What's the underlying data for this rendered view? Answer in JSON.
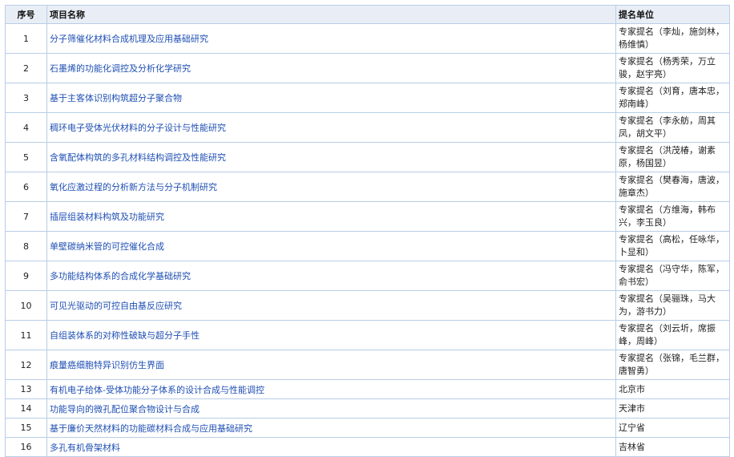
{
  "table": {
    "headers": [
      "序号",
      "项目名称",
      "提名单位"
    ],
    "rows": [
      {
        "no": "1",
        "name": "分子筛催化材料合成机理及应用基础研究",
        "unit": "专家提名（李灿，施剑林，杨维慎）"
      },
      {
        "no": "2",
        "name": "石墨烯的功能化调控及分析化学研究",
        "unit": "专家提名（杨秀荣，万立骏，赵宇亮）"
      },
      {
        "no": "3",
        "name": "基于主客体识别构筑超分子聚合物",
        "unit": "专家提名（刘育，唐本忠，郑南峰）"
      },
      {
        "no": "4",
        "name": "稠环电子受体光伏材料的分子设计与性能研究",
        "unit": "专家提名（李永舫，周其凤，胡文平）"
      },
      {
        "no": "5",
        "name": "含氧配体构筑的多孔材料结构调控及性能研究",
        "unit": "专家提名（洪茂椿，谢素原，杨国昱）"
      },
      {
        "no": "6",
        "name": "氧化应激过程的分析新方法与分子机制研究",
        "unit": "专家提名（樊春海，唐波，施章杰）"
      },
      {
        "no": "7",
        "name": "插层组装材料构筑及功能研究",
        "unit": "专家提名（方维海，韩布兴，李玉良）"
      },
      {
        "no": "8",
        "name": "单壁碳纳米管的可控催化合成",
        "unit": "专家提名（高松，任咏华，卜显和）"
      },
      {
        "no": "9",
        "name": "多功能结构体系的合成化学基础研究",
        "unit": "专家提名（冯守华，陈军，俞书宏）"
      },
      {
        "no": "10",
        "name": "可见光驱动的可控自由基反应研究",
        "unit": "专家提名（吴骊珠，马大为，游书力）"
      },
      {
        "no": "11",
        "name": "自组装体系的对称性破缺与超分子手性",
        "unit": "专家提名（刘云圻，席振峰，周峰）"
      },
      {
        "no": "12",
        "name": "痕量癌细胞特异识别仿生界面",
        "unit": "专家提名（张锦，毛兰群，唐智勇）"
      },
      {
        "no": "13",
        "name": "有机电子给体-受体功能分子体系的设计合成与性能调控",
        "unit": "北京市"
      },
      {
        "no": "14",
        "name": "功能导向的微孔配位聚合物设计与合成",
        "unit": "天津市"
      },
      {
        "no": "15",
        "name": "基于廉价天然材料的功能碳材料合成与应用基础研究",
        "unit": "辽宁省"
      },
      {
        "no": "16",
        "name": "多孔有机骨架材料",
        "unit": "吉林省"
      }
    ]
  }
}
